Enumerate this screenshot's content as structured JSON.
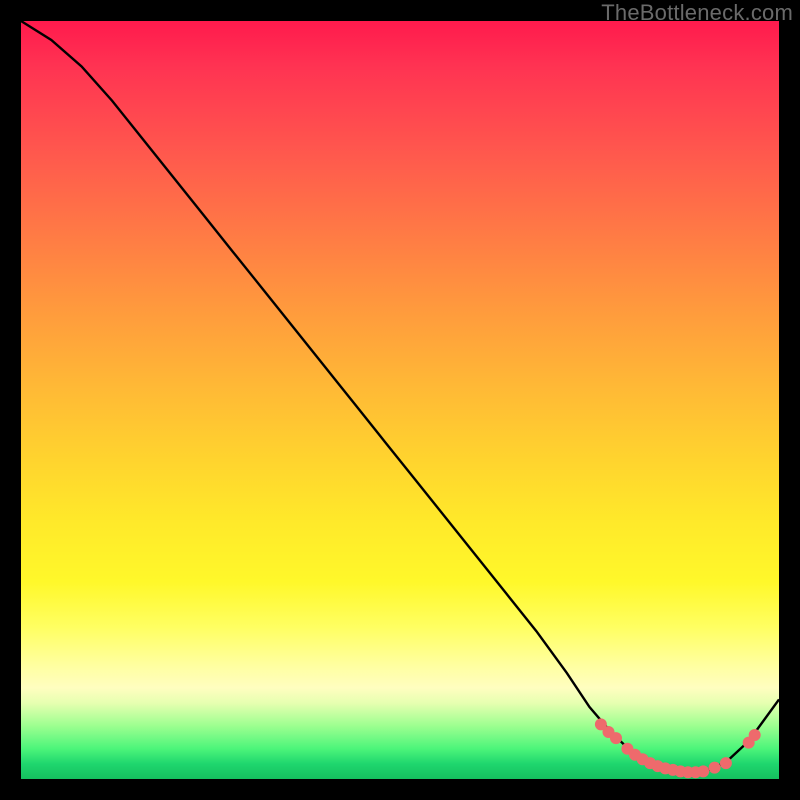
{
  "watermark": "TheBottleneck.com",
  "colors": {
    "curve": "#000000",
    "dot_fill": "#ee6a6c",
    "dot_stroke": "#ee6a6c"
  },
  "chart_data": {
    "type": "line",
    "title": "",
    "xlabel": "",
    "ylabel": "",
    "xlim": [
      0,
      100
    ],
    "ylim": [
      0,
      100
    ],
    "series": [
      {
        "name": "bottleneck-curve",
        "x": [
          0,
          4,
          8,
          12,
          16,
          20,
          24,
          28,
          32,
          36,
          40,
          44,
          48,
          52,
          56,
          60,
          64,
          68,
          72,
          75,
          78,
          81,
          84,
          87,
          90,
          93,
          96,
          100
        ],
        "y": [
          100,
          97.5,
          94,
          89.5,
          84.5,
          79.5,
          74.5,
          69.5,
          64.5,
          59.5,
          54.5,
          49.5,
          44.5,
          39.5,
          34.5,
          29.5,
          24.5,
          19.5,
          14.0,
          9.5,
          6.0,
          3.2,
          1.6,
          0.9,
          0.9,
          2.2,
          5.0,
          10.5
        ]
      }
    ],
    "dots": {
      "name": "highlight-dots",
      "x": [
        76.5,
        77.5,
        78.5,
        80,
        81,
        82,
        83,
        84,
        85,
        86,
        87,
        88,
        89,
        90,
        91.5,
        93,
        96,
        96.8
      ],
      "y": [
        7.2,
        6.2,
        5.4,
        4.0,
        3.2,
        2.6,
        2.1,
        1.7,
        1.4,
        1.2,
        1.0,
        0.9,
        0.9,
        1.0,
        1.5,
        2.1,
        4.8,
        5.8
      ]
    }
  }
}
